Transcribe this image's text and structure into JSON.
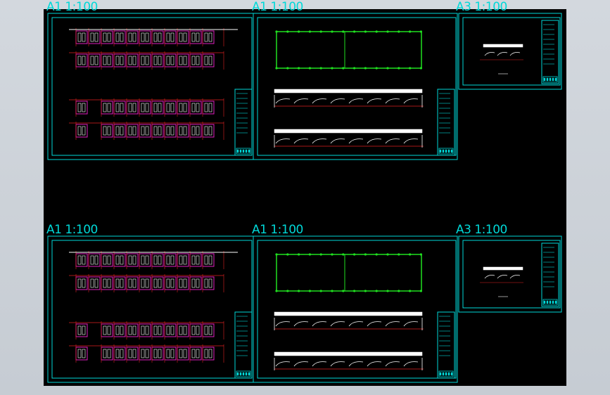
{
  "colors": {
    "background": "#c8ced5",
    "model_space": "#000000",
    "frame": "#00d8d8",
    "layout_magenta": "#e020c0",
    "grid_red": "#e02020",
    "site_green": "#20e020",
    "section_white": "#ffffff"
  },
  "sheets": [
    {
      "id": "top-left",
      "scale_label": "A1 1:100",
      "kind": "parking-plan"
    },
    {
      "id": "top-mid",
      "scale_label": "A1 1:100",
      "kind": "site-and-sections"
    },
    {
      "id": "top-right",
      "scale_label": "A3 1:100",
      "kind": "detail"
    },
    {
      "id": "bot-left",
      "scale_label": "A1 1:100",
      "kind": "parking-plan"
    },
    {
      "id": "bot-mid",
      "scale_label": "A1 1:100",
      "kind": "site-and-sections"
    },
    {
      "id": "bot-right",
      "scale_label": "A3 1:100",
      "kind": "detail"
    }
  ]
}
